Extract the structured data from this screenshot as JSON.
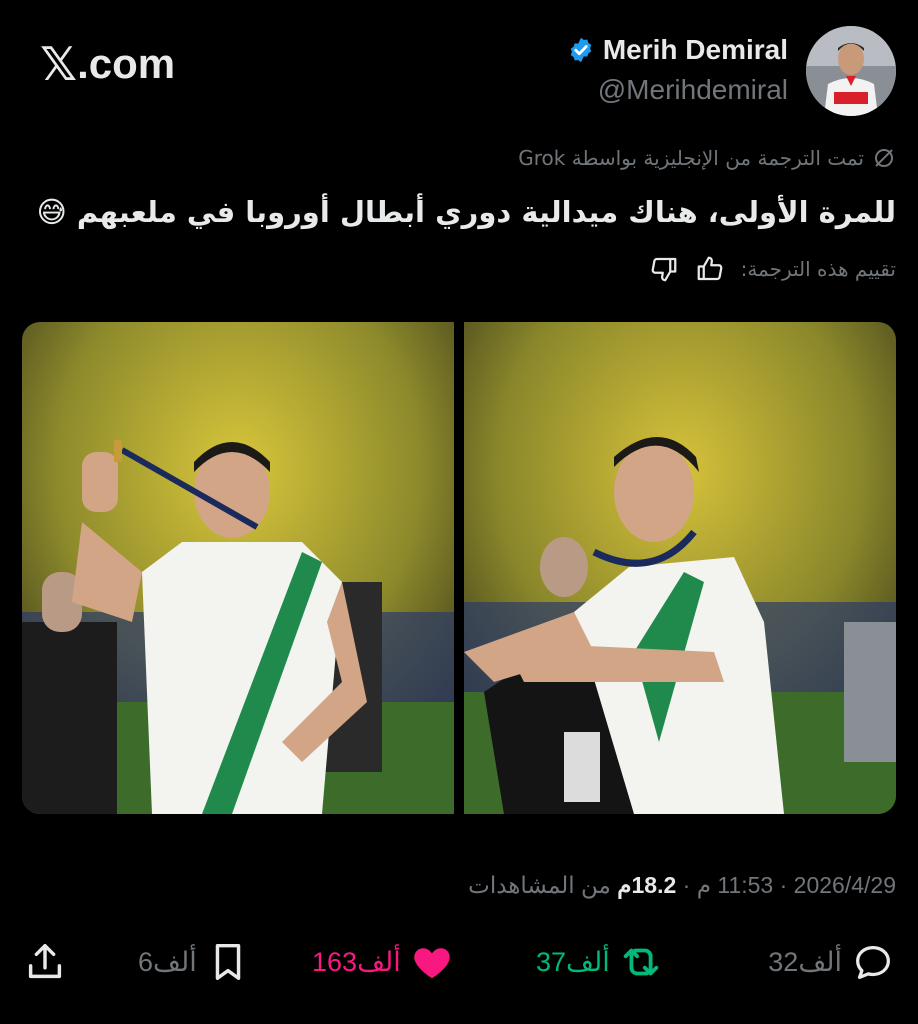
{
  "brand": {
    "x_glyph": "𝕏",
    "domain": ".com"
  },
  "author": {
    "display_name": "Merih Demiral",
    "handle": "@Merihdemiral",
    "verified_color": "#1d9bf0"
  },
  "translation": {
    "notice": "تمت الترجمة من الإنجليزية بواسطة Grok",
    "text": "للمرة الأولى، هناك ميدالية دوري أبطال أوروبا في ملعبهم 😅",
    "rate_prompt": "تقييم هذه الترجمة:"
  },
  "meta": {
    "date": "2026/4/29",
    "time": "11:53 م",
    "views_value": "18.2م",
    "views_label": "من المشاهدات"
  },
  "actions": {
    "replies": "32ألف",
    "reposts": "37ألف",
    "likes": "163ألف",
    "bookmarks": "6ألف"
  },
  "colors": {
    "repost": "#00ba7c",
    "like": "#f91880",
    "muted": "#71767b",
    "text": "#e7e9ea"
  }
}
